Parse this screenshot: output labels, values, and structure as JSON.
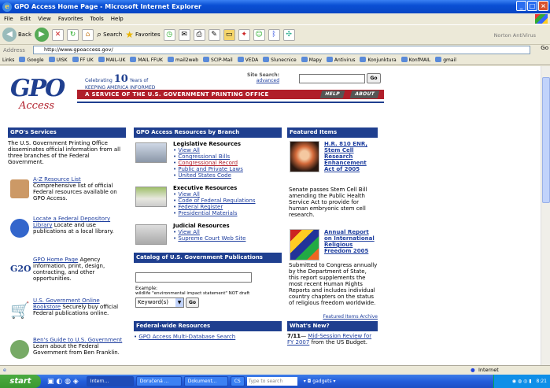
{
  "window": {
    "title": "GPO Access Home Page - Microsoft Internet Explorer",
    "min": "_",
    "max": "□",
    "close": "×"
  },
  "menu": [
    "File",
    "Edit",
    "View",
    "Favorites",
    "Tools",
    "Help"
  ],
  "toolbar": {
    "back": "Back",
    "search": "Search",
    "favorites": "Favorites",
    "norton": "Norton AntiVirus"
  },
  "address": {
    "label": "Address",
    "url": "http://www.gpoaccess.gov/",
    "go": "Go"
  },
  "links": {
    "label": "Links",
    "items": [
      "Google",
      "UISK",
      "FF UK",
      "MAIL-UK",
      "MAIL FFUK",
      "mail2web",
      "SCIP-Mail",
      "VEDA",
      "Slunecnice",
      "Mapy",
      "Antivirus",
      "Konjunktura",
      "KonfMAIL",
      "gmail"
    ]
  },
  "header": {
    "logo_main": "GPO",
    "logo_sub": "Access",
    "celebrating_pre": "Celebrating",
    "celebrating_num": "10",
    "celebrating_years": "Years of",
    "celebrating_line2": "KEEPING AMERICA INFORMED",
    "site_search": "Site Search:",
    "advanced": "advanced",
    "go": "Go",
    "banner": "A SERVICE OF THE U.S. GOVERNMENT PRINTING OFFICE",
    "help": "HELP",
    "about": "ABOUT"
  },
  "col1": {
    "title": "GPO's Services",
    "intro": "The U.S. Government Printing Office disseminates official information from all three branches of the Federal Government.",
    "items": [
      {
        "link": "A-Z Resource List",
        "text": "Comprehensive list of official Federal resources available on GPO Access.",
        "icon": "notebook-icon",
        "color": "#c96"
      },
      {
        "link": "Locate a Federal Depository Library",
        "text": "Locate and use publications at a local library.",
        "icon": "depository-seal-icon",
        "color": "#36c"
      },
      {
        "link": "GPO Home Page",
        "text": "Agency information, print, design, contracting, and other opportunities.",
        "icon": "gpo-logo-icon",
        "color": "#1f3f8f"
      },
      {
        "link": "U.S. Government Online Bookstore",
        "text": "Securely buy official Federal publications online.",
        "icon": "shopping-cart-icon",
        "color": "#888"
      },
      {
        "link": "Ben's Guide to U.S. Government",
        "text": "Learn about the Federal Government from Ben Franklin.",
        "icon": "ben-franklin-icon",
        "color": "#7a6"
      }
    ]
  },
  "col2": {
    "title": "GPO Access Resources by Branch",
    "legislative": {
      "title": "Legislative Resources",
      "links": [
        "View All",
        "Congressional Bills",
        "Congressional Record",
        "Public and Private Laws",
        "United States Code"
      ]
    },
    "executive": {
      "title": "Executive Resources",
      "links": [
        "View All",
        "Code of Federal Regulations",
        "Federal Register",
        "Presidential Materials"
      ]
    },
    "judicial": {
      "title": "Judicial Resources",
      "links": [
        "View All",
        "Supreme Court Web Site"
      ]
    },
    "catalog": {
      "title": "Catalog of U.S. Government Publications",
      "example_label": "Example:",
      "example": "wildlife \"environmental impact statement\" NOT draft",
      "select": "Keyword(s)",
      "go": "Go"
    },
    "federal": {
      "title": "Federal-wide Resources",
      "links": [
        "GPO Access Multi-Database Search"
      ]
    }
  },
  "col3": {
    "title": "Featured Items",
    "item1": {
      "link": "H.R. 810 ENR, Stem Cell Research Enhancement Act of 2005",
      "text": "Senate passes Stem Cell Bill amending the Public Health Service Act to provide for human embryonic stem cell research."
    },
    "item2": {
      "link": "Annual Report on International Religious Freedom 2005",
      "text": "Submitted to Congress annually by the Department of State, this report supplements the most recent Human Rights Reports and includes individual country chapters on the status of religious freedom worldwide."
    },
    "archive": "Featured Items Archive",
    "whatsnew": {
      "title": "What's New?",
      "date": "7/11",
      "link": "Mid-Session Review for FY 2007",
      "text": "from the US Budget."
    }
  },
  "status": {
    "zone": "Internet"
  },
  "taskbar": {
    "start": "start",
    "tasks": [
      "Intern...",
      "Doručená ...",
      "Dokument...",
      "CS"
    ],
    "search": "Type to search",
    "gadgets": "gadgets",
    "time": "8:21"
  }
}
